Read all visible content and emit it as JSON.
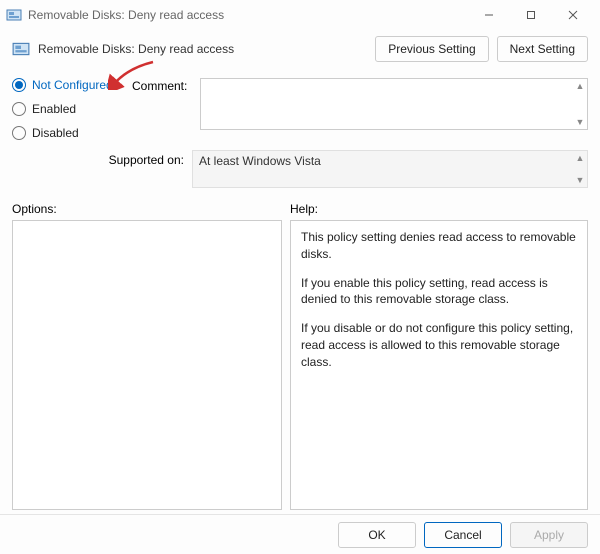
{
  "window": {
    "title": "Removable Disks: Deny read access"
  },
  "header": {
    "policyName": "Removable Disks: Deny read access"
  },
  "nav": {
    "previous": "Previous Setting",
    "next": "Next Setting"
  },
  "state": {
    "options": [
      {
        "value": "not_configured",
        "label": "Not Configured",
        "checked": true
      },
      {
        "value": "enabled",
        "label": "Enabled",
        "checked": false
      },
      {
        "value": "disabled",
        "label": "Disabled",
        "checked": false
      }
    ]
  },
  "comment": {
    "label": "Comment:",
    "value": ""
  },
  "supported": {
    "label": "Supported on:",
    "value": "At least Windows Vista"
  },
  "sections": {
    "options": "Options:",
    "help": "Help:"
  },
  "help": {
    "p1": "This policy setting denies read access to removable disks.",
    "p2": "If you enable this policy setting, read access is denied to this removable storage class.",
    "p3": "If you disable or do not configure this policy setting, read access is allowed to this removable storage class."
  },
  "buttons": {
    "ok": "OK",
    "cancel": "Cancel",
    "apply": "Apply"
  }
}
